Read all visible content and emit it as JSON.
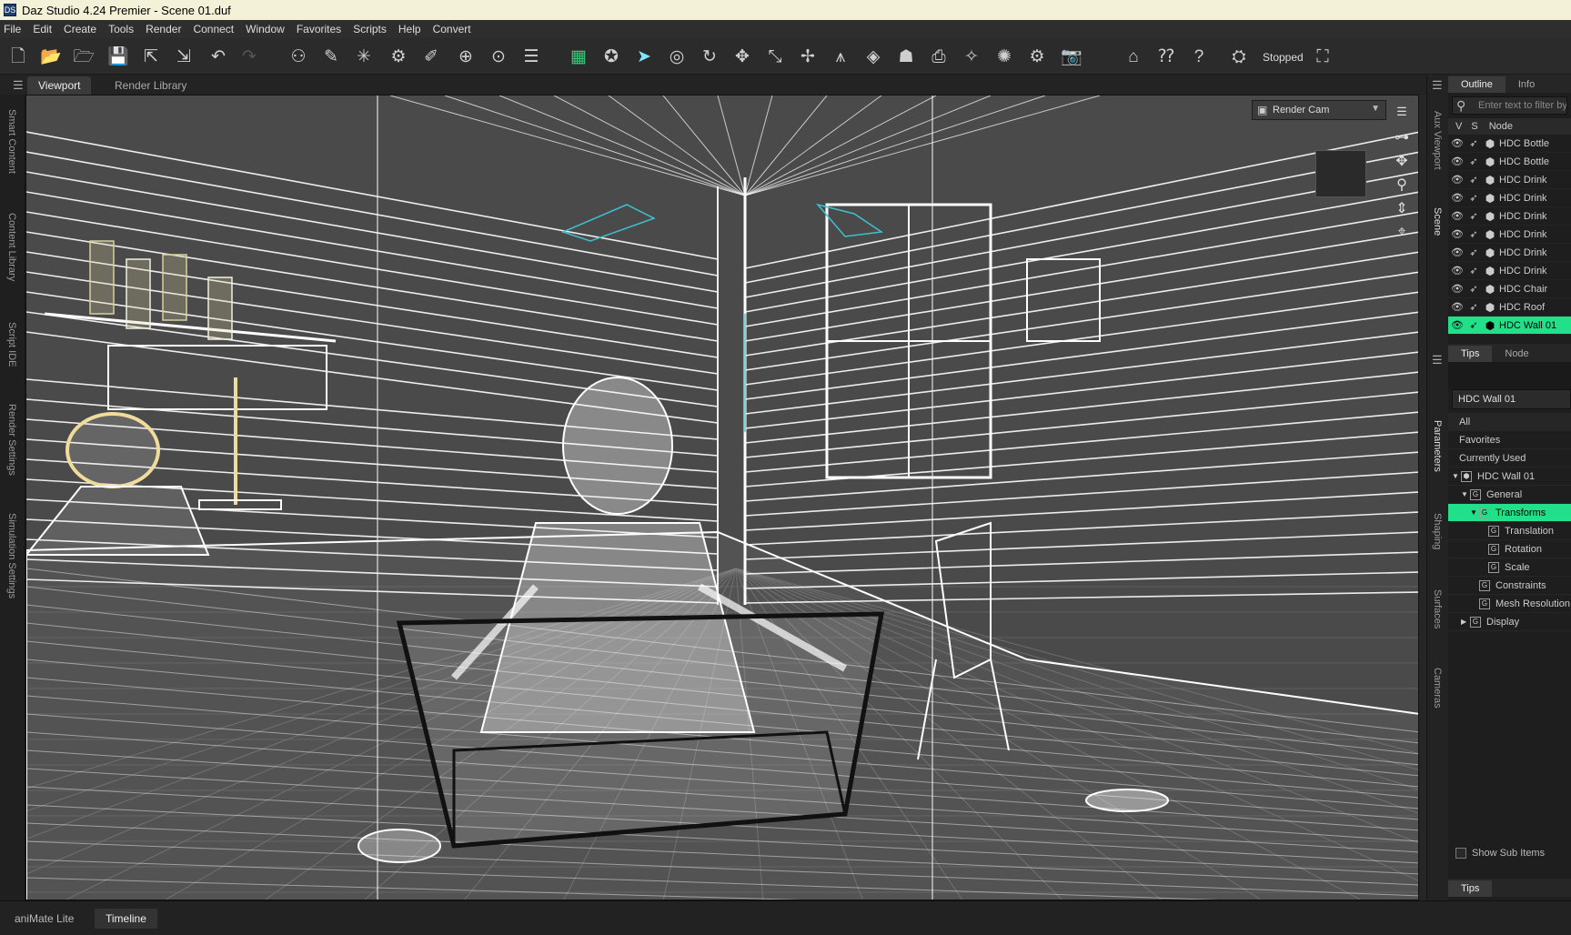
{
  "window": {
    "title": "Daz Studio 4.24 Premier - Scene 01.duf",
    "app_icon": "DS"
  },
  "menu": [
    "File",
    "Edit",
    "Create",
    "Tools",
    "Render",
    "Connect",
    "Window",
    "Favorites",
    "Scripts",
    "Help",
    "Convert"
  ],
  "toolbar": {
    "status_text": "Stopped",
    "icons": [
      "new-file-icon",
      "open-file-icon",
      "open-recent-icon",
      "save-icon",
      "import-icon",
      "export-icon",
      "undo-icon",
      "redo-icon",
      "figure-icon",
      "bone-icon",
      "light-icon",
      "gear-node-icon",
      "pin-icon",
      "node-select-icon",
      "select-region-icon",
      "align-icon",
      "grid-icon",
      "universal-tool-icon",
      "selection-arrow-icon",
      "orbit-icon",
      "rotate-icon",
      "translate-icon",
      "scale-icon",
      "joint-editor-icon",
      "geometry-editor-icon",
      "surface-selection-icon",
      "active-pose-icon",
      "camera-add-icon",
      "light-add-icon",
      "render-settings-icon",
      "render-icon",
      "home-icon",
      "whats-this-icon",
      "help-icon",
      "iray-icon",
      "drawing-icon"
    ]
  },
  "viewport_tabs": {
    "active": "Viewport",
    "other": "Render Library"
  },
  "left_panes": [
    "Smart Content",
    "Content Library",
    "Script IDE",
    "Render Settings",
    "Simulation Settings"
  ],
  "viewport": {
    "camera": "Render Cam",
    "background_color": "#4a4a4a",
    "wire_color": "#ffffff",
    "accent_wire": "#3fc0d0"
  },
  "middle_panes": [
    "Aux Viewport",
    "Scene",
    "Parameters",
    "Shaping",
    "Surfaces",
    "Cameras"
  ],
  "scene_panel": {
    "tabs": [
      "Outline",
      "Info"
    ],
    "filter_placeholder": "Enter text to filter by...",
    "columns": [
      "V",
      "S",
      "Node"
    ],
    "nodes": [
      "HDC Bottle",
      "HDC Bottle",
      "HDC Drink",
      "HDC Drink",
      "HDC Drink",
      "HDC Drink",
      "HDC Drink",
      "HDC Drink",
      "HDC Chair",
      "HDC Roof",
      "HDC Wall 01"
    ],
    "selected_index": 10,
    "bottom_tabs": [
      "Tips",
      "Node"
    ]
  },
  "parameters_panel": {
    "node_field": "HDC Wall 01",
    "categories": [
      "All",
      "Favorites",
      "Currently Used"
    ],
    "tree": [
      {
        "label": "HDC Wall 01",
        "depth": 0,
        "expander": "▼"
      },
      {
        "label": "General",
        "depth": 1,
        "expander": "▼"
      },
      {
        "label": "Transforms",
        "depth": 2,
        "expander": "▼"
      },
      {
        "label": "Translation",
        "depth": 3,
        "expander": ""
      },
      {
        "label": "Rotation",
        "depth": 3,
        "expander": ""
      },
      {
        "label": "Scale",
        "depth": 3,
        "expander": ""
      },
      {
        "label": "Constraints",
        "depth": 2,
        "expander": ""
      },
      {
        "label": "Mesh Resolution",
        "depth": 2,
        "expander": ""
      },
      {
        "label": "Display",
        "depth": 1,
        "expander": "▶"
      }
    ],
    "selected_index": 2,
    "show_sub_items_label": "Show Sub Items",
    "bottom_tab": "Tips"
  },
  "bottom_tabs": [
    "aniMate Lite",
    "Timeline"
  ],
  "colors": {
    "selection_green": "#21e089",
    "highlight_blue": "#7ee5ff"
  }
}
